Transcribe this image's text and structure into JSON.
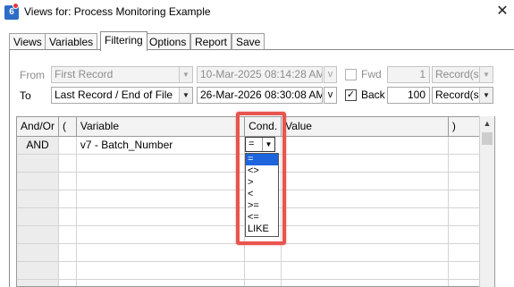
{
  "window": {
    "title": "Views for: Process Monitoring Example",
    "close_glyph": "✕",
    "icon_letter": "6"
  },
  "tabs": [
    {
      "label": "Views"
    },
    {
      "label": "Variables"
    },
    {
      "label": "Filtering"
    },
    {
      "label": "Options"
    },
    {
      "label": "Report"
    },
    {
      "label": "Save"
    }
  ],
  "active_tab": "Filtering",
  "from_row": {
    "label": "From",
    "record_select": "First Record",
    "datetime": "10-Mar-2025  08:14:28 AM",
    "v_button": "v",
    "fwd_label": "Fwd",
    "fwd_checked": false,
    "count": "1",
    "unit_select": "Record(s)"
  },
  "to_row": {
    "label": "To",
    "record_select": "Last Record / End of File",
    "datetime": "26-Mar-2026  08:30:08 AM",
    "v_button": "v",
    "back_label": "Back",
    "back_checked": true,
    "count": "100",
    "unit_select": "Record(s)"
  },
  "grid": {
    "headers": [
      "And/Or",
      "(",
      "Variable",
      "Cond.",
      "Value",
      ")"
    ],
    "rows": [
      {
        "andor": "AND",
        "open": "",
        "variable": "v7 - Batch_Number",
        "cond": "=",
        "value": "",
        "close": ""
      }
    ]
  },
  "cond_dropdown": {
    "current": "=",
    "options": [
      "=",
      "<>",
      ">",
      "<",
      ">=",
      "<=",
      "LIKE"
    ],
    "selected_index": 0
  },
  "colors": {
    "highlight": "#e8544e",
    "selection": "#1e64dc"
  }
}
